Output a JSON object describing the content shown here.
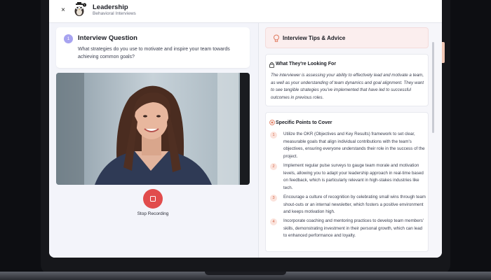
{
  "header": {
    "title": "Leadership",
    "subtitle": "Behavioral Interviews",
    "close_label": "×"
  },
  "question": {
    "number": "1",
    "title": "Interview Question",
    "text": "What strategies do you use to motivate and inspire your team towards achieving common goals?"
  },
  "recording": {
    "label": "Stop Recording"
  },
  "tips": {
    "title": "Interview Tips & Advice",
    "looking_for": {
      "title": "What They're Looking For",
      "text": "The interviewer is assessing your ability to effectively lead and motivate a team, as well as your understanding of team dynamics and goal alignment. They want to see tangible strategies you've implemented that have led to successful outcomes in previous roles."
    },
    "points": {
      "title": "Specific Points to Cover",
      "items": [
        {
          "num": "1",
          "text": "Utilize the OKR (Objectives and Key Results) framework to set clear, measurable goals that align individual contributions with the team's objectives, ensuring everyone understands their role in the success of the project."
        },
        {
          "num": "2",
          "text": "Implement regular pulse surveys to gauge team morale and motivation levels, allowing you to adapt your leadership approach in real-time based on feedback, which is particularly relevant in high-stakes industries like tech."
        },
        {
          "num": "3",
          "text": "Encourage a culture of recognition by celebrating small wins through team shout-outs or an internal newsletter, which fosters a positive environment and keeps motivation high."
        },
        {
          "num": "4",
          "text": "Incorporate coaching and mentoring practices to develop team members' skills, demonstrating investment in their personal growth, which can lead to enhanced performance and loyalty."
        }
      ]
    }
  },
  "colors": {
    "accent": "#a7a3f0",
    "record": "#e14c4c",
    "tips_bg": "#fbeeee",
    "point_badge": "#fbe3dc"
  },
  "icons": [
    "close-icon",
    "owl-avatar-icon",
    "lightbulb-icon",
    "lock-icon",
    "target-icon",
    "stop-icon"
  ]
}
